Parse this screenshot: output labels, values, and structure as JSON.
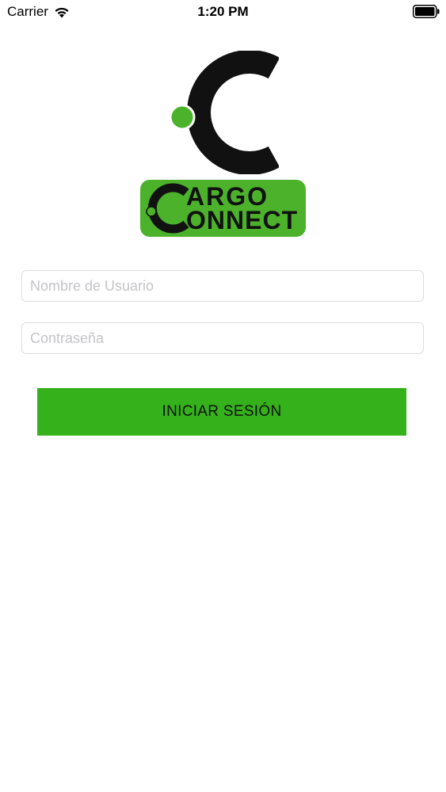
{
  "status_bar": {
    "carrier": "Carrier",
    "time": "1:20 PM",
    "wifi_icon": "wifi-icon",
    "battery_icon": "battery-icon"
  },
  "logo": {
    "word_top": "ARGO",
    "word_bottom": "ONNECT",
    "brand_green": "#4cb22b",
    "brand_dark": "#111111"
  },
  "form": {
    "username": {
      "value": "",
      "placeholder": "Nombre de Usuario"
    },
    "password": {
      "value": "",
      "placeholder": "Contraseña"
    },
    "login_label": "INICIAR SESIÓN",
    "button_color": "#34b11b"
  }
}
